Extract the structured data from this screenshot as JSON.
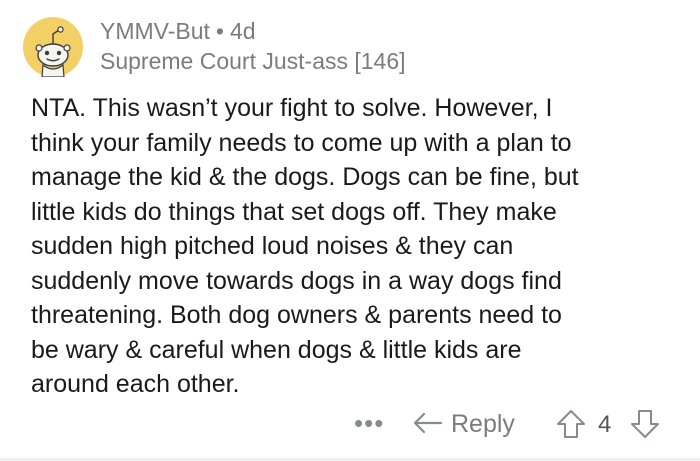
{
  "comment": {
    "username": "YMMV-But",
    "separator": "•",
    "age": "4d",
    "flair": "Supreme Court Just-ass [146]",
    "body": "NTA. This wasn’t your fight to solve. However, I\nthink your family needs to come up with a plan to\nmanage the kid & the dogs.  Dogs can be fine, but\nlittle kids do things that set dogs off. They make\nsudden high pitched loud noises & they can\nsuddenly move towards dogs in a way dogs find\nthreatening. Both dog owners & parents need to\nbe wary & careful when dogs & little kids are\naround each other."
  },
  "actions": {
    "more_icon": "more-icon",
    "more_label": "•••",
    "reply_label": "Reply",
    "score": "4"
  },
  "colors": {
    "avatar_bg": "#f2d066",
    "meta_text": "#7c7c7c",
    "body_text": "#1a1a1b",
    "icon_gray": "#878a8c"
  }
}
